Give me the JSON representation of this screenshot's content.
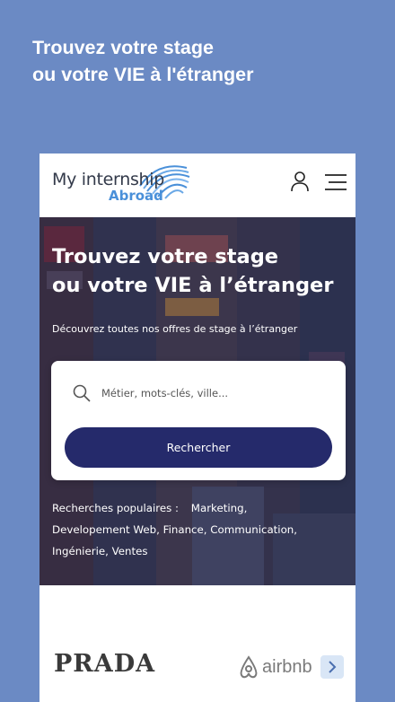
{
  "promo": {
    "title_line1": "Trouvez votre stage",
    "title_line2": "ou votre VIE à l'étranger"
  },
  "header": {
    "logo_text": "My internship",
    "logo_sub": "Abroad",
    "user_icon": "user-icon",
    "menu_icon": "hamburger-menu-icon"
  },
  "hero": {
    "title_line1": "Trouvez votre stage",
    "title_line2": "ou votre VIE à l’étranger",
    "subtitle": "Découvrez toutes nos offres de stage à l’étranger"
  },
  "search": {
    "placeholder": "Métier, mots-clés, ville...",
    "button_label": "Rechercher"
  },
  "popular": {
    "label": "Recherches populaires :",
    "items": [
      "Marketing",
      "Developement Web",
      "Finance",
      "Communication",
      "Ingénierie",
      "Ventes"
    ]
  },
  "brands": {
    "prada": "PRADA",
    "airbnb": "airbnb"
  },
  "colors": {
    "background": "#6b8ac4",
    "primary_button": "#252a6b",
    "logo_accent": "#4a90d9"
  }
}
